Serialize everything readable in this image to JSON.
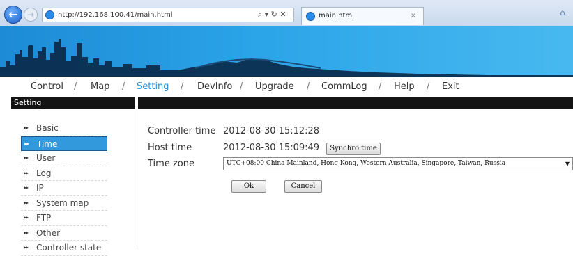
{
  "browser": {
    "url": "http://192.168.100.41/main.html",
    "tools": "⌕ ▾ ↻ ✕",
    "tab_title": "main.html",
    "tab_close": "×",
    "back_glyph": "←",
    "forward_glyph": "→",
    "home_glyph": "⌂"
  },
  "menu": {
    "items": [
      "Control",
      "Map",
      "Setting",
      "DevInfo",
      "Upgrade",
      "CommLog",
      "Help",
      "Exit"
    ],
    "separator": "/",
    "active": "Setting"
  },
  "section": {
    "title": "Setting"
  },
  "sidebar": {
    "bullet": "▸▸",
    "items": [
      "Basic",
      "Time",
      "User",
      "Log",
      "IP",
      "System map",
      "FTP",
      "Other",
      "Controller state"
    ],
    "selected": "Time"
  },
  "time_form": {
    "controller_time_label": "Controller time",
    "controller_time_value": "2012-08-30 15:12:28",
    "host_time_label": "Host time",
    "host_time_value": "2012-08-30 15:09:49",
    "synchro_button": "Synchro time",
    "time_zone_label": "Time zone",
    "time_zone_value": "UTC+08:00 China Mainland, Hong Kong, Western Australia, Singapore, Taiwan, Russia",
    "ok_button": "Ok",
    "cancel_button": "Cancel"
  },
  "colors": {
    "banner": "#2ba4e8",
    "active_menu": "#2a8fd8",
    "selection": "#3399dd",
    "header_bar": "#141414"
  },
  "icons": {
    "back": "back-arrow-icon",
    "forward": "forward-arrow-icon",
    "browser": "ie-icon",
    "home": "home-icon",
    "dropdown": "chevron-down-icon"
  }
}
